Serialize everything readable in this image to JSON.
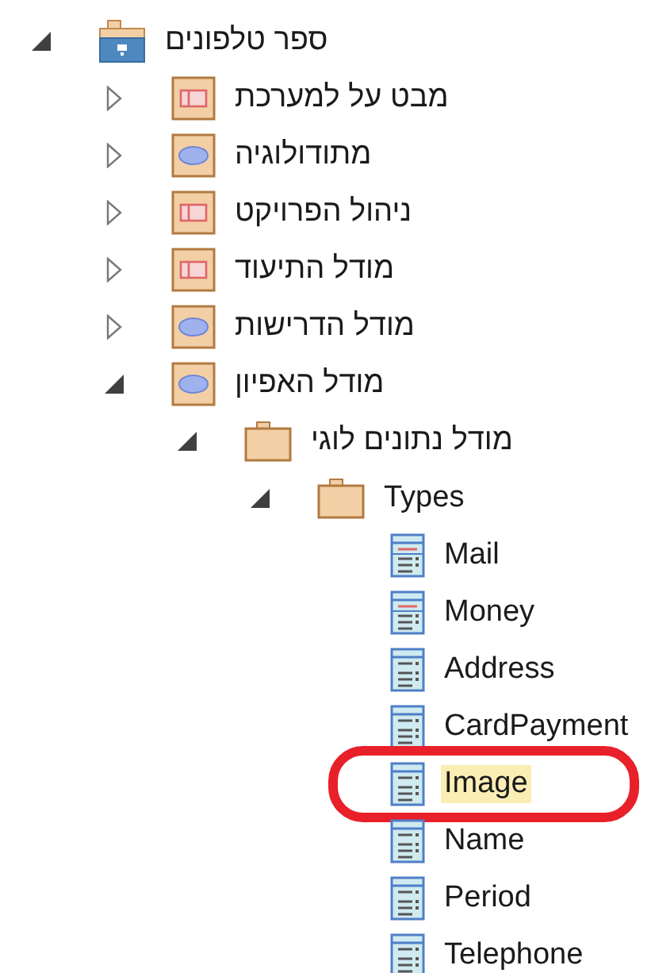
{
  "tree": [
    {
      "label": "ספר טלפונים",
      "kind": "package",
      "expanded": true,
      "selected": false,
      "circled": false,
      "children": [
        {
          "label": "מבט על למערכת",
          "kind": "diagram-box",
          "expanded": false,
          "selected": false,
          "circled": false
        },
        {
          "label": "מתודולוגיה",
          "kind": "diagram-oval",
          "expanded": false,
          "selected": false,
          "circled": false
        },
        {
          "label": "ניהול הפרויקט",
          "kind": "diagram-box",
          "expanded": false,
          "selected": false,
          "circled": false
        },
        {
          "label": "מודל התיעוד",
          "kind": "diagram-box",
          "expanded": false,
          "selected": false,
          "circled": false
        },
        {
          "label": "מודל הדרישות",
          "kind": "diagram-oval",
          "expanded": false,
          "selected": false,
          "circled": false
        },
        {
          "label": "מודל האפיון",
          "kind": "diagram-oval",
          "expanded": true,
          "selected": false,
          "circled": false,
          "children": [
            {
              "label": "מודל נתונים לוגי",
              "kind": "folder",
              "expanded": true,
              "selected": false,
              "circled": false,
              "children": [
                {
                  "label": "Types",
                  "kind": "folder",
                  "expanded": true,
                  "selected": false,
                  "circled": false,
                  "children": [
                    {
                      "label": "Mail",
                      "kind": "class-marked",
                      "selected": false,
                      "circled": false
                    },
                    {
                      "label": "Money",
                      "kind": "class-marked",
                      "selected": false,
                      "circled": false
                    },
                    {
                      "label": "Address",
                      "kind": "class",
                      "selected": false,
                      "circled": false
                    },
                    {
                      "label": "CardPayment",
                      "kind": "class",
                      "selected": false,
                      "circled": false
                    },
                    {
                      "label": "Image",
                      "kind": "class",
                      "selected": true,
                      "circled": true
                    },
                    {
                      "label": "Name",
                      "kind": "class",
                      "selected": false,
                      "circled": false
                    },
                    {
                      "label": "Period",
                      "kind": "class",
                      "selected": false,
                      "circled": false
                    },
                    {
                      "label": "Telephone",
                      "kind": "class",
                      "selected": false,
                      "circled": false
                    }
                  ]
                }
              ]
            }
          ]
        }
      ]
    }
  ]
}
